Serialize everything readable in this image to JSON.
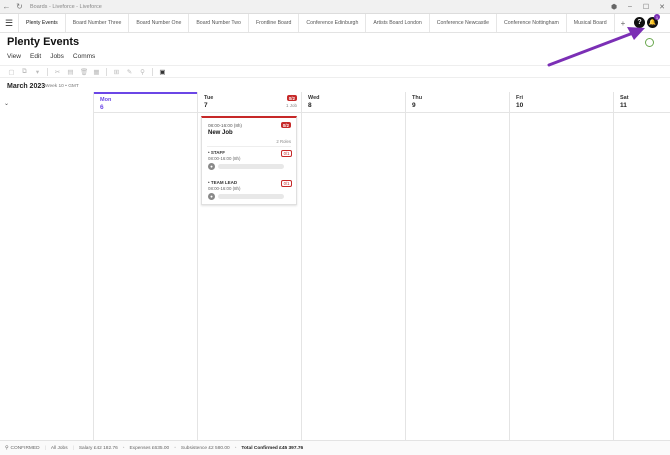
{
  "window": {
    "title": "Boards - Liveforce - Liveforce"
  },
  "tabs": [
    {
      "label": "Plenty Events",
      "active": true
    },
    {
      "label": "Board Number Three"
    },
    {
      "label": "Board Number One"
    },
    {
      "label": "Board Number Two"
    },
    {
      "label": "Frontline Board"
    },
    {
      "label": "Conference Edinburgh"
    },
    {
      "label": "Artists Board London"
    },
    {
      "label": "Conference Newcastle"
    },
    {
      "label": "Conference Nottingham"
    },
    {
      "label": "Musical Board"
    }
  ],
  "header": {
    "help_label": "?",
    "notif_count": "1",
    "page_title": "Plenty Events"
  },
  "menu": [
    "View",
    "Edit",
    "Jobs",
    "Comms"
  ],
  "calendar": {
    "month": "March 2023",
    "week_info": "Week 10 • GMT",
    "days": [
      {
        "name": "Mon",
        "num": "6",
        "today": true
      },
      {
        "name": "Tue",
        "num": "7",
        "badge": "0/2",
        "jobs": "1 Job"
      },
      {
        "name": "Wed",
        "num": "8"
      },
      {
        "name": "Thu",
        "num": "9"
      },
      {
        "name": "Fri",
        "num": "10"
      },
      {
        "name": "Sat",
        "num": "11"
      }
    ]
  },
  "job": {
    "time": "08:00-16:00 (8h)",
    "badge": "0/2",
    "title": "New Job",
    "roles_count": "2 Roles",
    "roles": [
      {
        "name": "• STAFF",
        "count": "0/1",
        "time": "08:00-16:00 (8h)"
      },
      {
        "name": "• TEAM LEAD",
        "count": "0/1",
        "time": "08:00-16:00 (8h)"
      }
    ]
  },
  "statusbar": {
    "confirmed": "CONFIRMED",
    "all_jobs": "All Jobs",
    "salary": "Salary £42 182.76",
    "expenses": "Expenses £635.00",
    "subsistence": "Subsistence £2 580.00",
    "total": "Total Confirmed £45 397.76"
  },
  "colors": {
    "accent": "#6b46e6",
    "alert": "#c62828",
    "annotation_arrow": "#7b2fb5"
  }
}
